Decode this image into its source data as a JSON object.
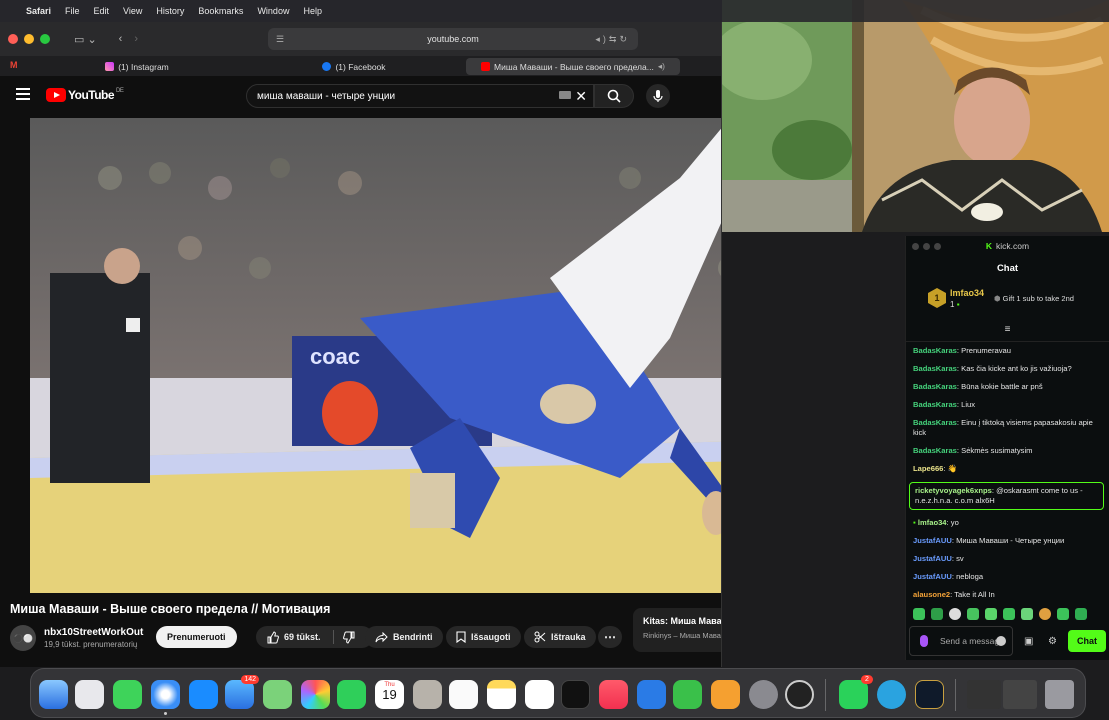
{
  "menubar": {
    "app": "Safari",
    "items": [
      "File",
      "Edit",
      "View",
      "History",
      "Bookmarks",
      "Window",
      "Help"
    ]
  },
  "browser": {
    "address": "youtube.com",
    "tabs": [
      {
        "label": "(1) Instagram",
        "icon": "instagram-icon"
      },
      {
        "label": "(1) Facebook",
        "icon": "facebook-icon"
      },
      {
        "label": "Миша Маваши - Выше своего предела...",
        "icon": "youtube-icon",
        "active": true
      }
    ]
  },
  "youtube": {
    "logo_text": "YouTube",
    "country_code": "DE",
    "search_value": "миша маваши - четыре унции",
    "video_title": "Миша Маваши - Выше своего предела // Мотивация",
    "channel_name": "nbx10StreetWorkOut",
    "channel_subs": "19,9 tūkst. prenumeratorių",
    "subscribe_label": "Prenumeruoti",
    "likes": "69 tūkst.",
    "share_label": "Bendrinti",
    "save_label": "Išsaugoti",
    "clip_label": "Ištrauka",
    "next_title": "Kitas: Миша Маваши - Мои правила (Official Vide...",
    "next_sub": "Rinkinys – Миша Маваши - Четыре унции"
  },
  "kick": {
    "window_title": "kick.com",
    "chat_title": "Chat",
    "gifter": {
      "rank": "1",
      "name": "lmfao34",
      "count": "1",
      "text": "Gift 1 sub to take 2nd"
    },
    "messages": [
      {
        "user": "BadasKaras",
        "text": "Prenumeravau",
        "color": "#45d37c"
      },
      {
        "user": "BadasKaras",
        "text": "Kas čia kicke ant ko jis važiuoja?",
        "color": "#45d37c"
      },
      {
        "user": "BadasKaras",
        "text": "Būna kokie battle ar pnš",
        "color": "#45d37c"
      },
      {
        "user": "BadasKaras",
        "text": "Liux",
        "color": "#45d37c"
      },
      {
        "user": "BadasKaras",
        "text": "Einu į tiktoką visiems papasakosiu apie kick",
        "color": "#45d37c"
      },
      {
        "user": "BadasKaras",
        "text": "Sėkmės susimatysim",
        "color": "#45d37c"
      },
      {
        "user": "Lape666",
        "text": "👋",
        "color": "#e9e28a"
      },
      {
        "user": "ricketyvoyagek6xnps",
        "text": "@oskarasmt come to us - n.e.z.h.n.a. c.o.m alx6H",
        "color": "#a8f28a",
        "highlight": true
      },
      {
        "user": "lmfao34",
        "text": "yo",
        "color": "#a8f28a"
      },
      {
        "user": "JustafAUU",
        "text": "Миша Маваши - Четыре унции",
        "color": "#6a9cff"
      },
      {
        "user": "JustafAUU",
        "text": "sv",
        "color": "#6a9cff"
      },
      {
        "user": "JustafAUU",
        "text": "nebloga",
        "color": "#6a9cff"
      },
      {
        "user": "alausone2",
        "text": "Take it All In",
        "color": "#f4a338"
      }
    ],
    "input_placeholder": "Send a message",
    "chat_button": "Chat"
  },
  "dock": {
    "mail_badge": "142",
    "whatsapp_badge": "2",
    "calendar_day": "19",
    "calendar_month": "Thu"
  }
}
